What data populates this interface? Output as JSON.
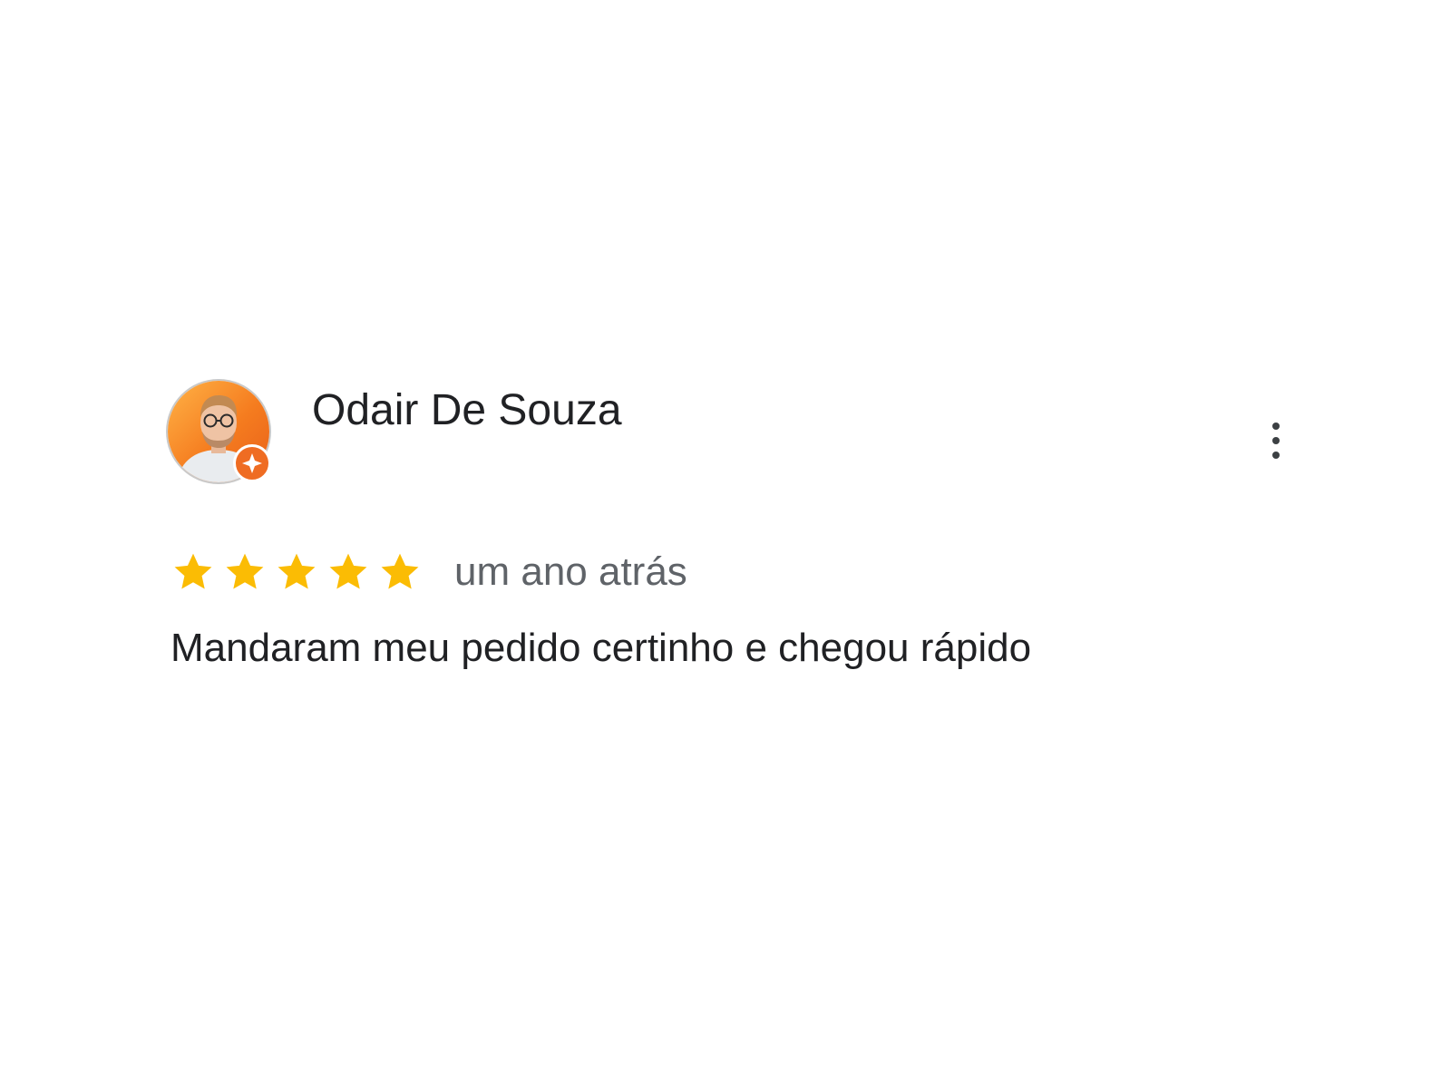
{
  "review": {
    "author": {
      "name": "Odair De Souza",
      "avatar_icon": "person-avatar",
      "badge_icon": "local-guide-badge-icon",
      "badge_color": "#ef6c22"
    },
    "menu_icon": "more-vert-icon",
    "rating": {
      "value": 5,
      "max": 5,
      "star_color": "#fbbc04"
    },
    "date": "um ano atrás",
    "text": "Mandaram meu pedido certinho e chegou rápido"
  }
}
